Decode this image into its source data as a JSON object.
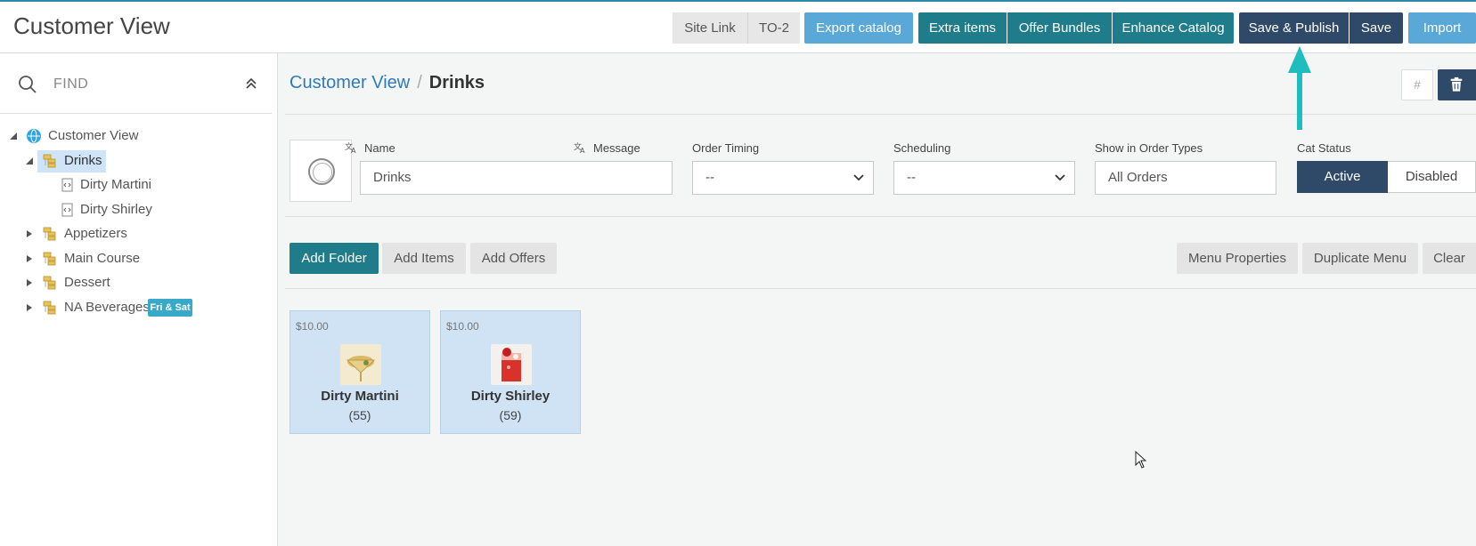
{
  "header": {
    "title": "Customer View",
    "buttons": {
      "site_link": "Site Link",
      "to2": "TO-2",
      "export_catalog": "Export catalog",
      "extra_items": "Extra items",
      "offer_bundles": "Offer Bundles",
      "enhance_catalog": "Enhance Catalog",
      "save_publish": "Save & Publish",
      "save": "Save",
      "import": "Import"
    }
  },
  "sidebar": {
    "search_placeholder": "FIND",
    "tree": {
      "root": "Customer View",
      "drinks": "Drinks",
      "drink_children": [
        "Dirty Martini",
        "Dirty Shirley"
      ],
      "appetizers": "Appetizers",
      "main_course": "Main Course",
      "dessert": "Dessert",
      "na_beverages": "NA Beverages",
      "na_badge": "Fri & Sat"
    }
  },
  "main": {
    "breadcrumb": {
      "parent": "Customer View",
      "separator": "/",
      "current": "Drinks"
    },
    "hash_label": "#",
    "form": {
      "name_label": "Name",
      "message_label": "Message",
      "name_value": "Drinks",
      "order_timing_label": "Order Timing",
      "order_timing_value": "--",
      "scheduling_label": "Scheduling",
      "scheduling_value": "--",
      "order_types_label": "Show in Order Types",
      "order_types_value": "All Orders",
      "cat_status_label": "Cat Status",
      "status_active": "Active",
      "status_disabled": "Disabled"
    },
    "actions": {
      "add_folder": "Add Folder",
      "add_items": "Add Items",
      "add_offers": "Add Offers",
      "menu_properties": "Menu Properties",
      "duplicate_menu": "Duplicate Menu",
      "clear": "Clear"
    },
    "items": [
      {
        "price": "$10.00",
        "name": "Dirty Martini",
        "count": "(55)"
      },
      {
        "price": "$10.00",
        "name": "Dirty Shirley",
        "count": "(59)"
      }
    ]
  },
  "colors": {
    "teal": "#1f7c8a",
    "navy": "#2e4a68",
    "light_blue": "#5aa8d7",
    "annotation_arrow": "#1fbcc0",
    "selected": "#cfe4f8"
  }
}
